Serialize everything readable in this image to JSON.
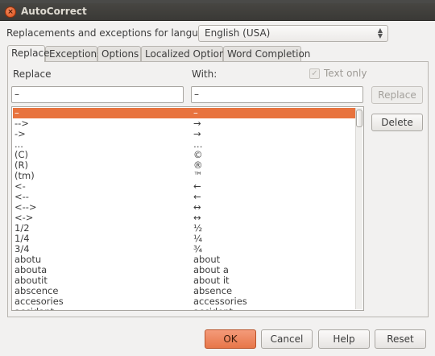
{
  "window": {
    "title": "AutoCorrect",
    "close_glyph": "×"
  },
  "language": {
    "label": "Replacements and exceptions for language:",
    "selected": "English (USA)"
  },
  "tabs": [
    {
      "label": "Replace",
      "active": true
    },
    {
      "label": "Exceptions",
      "active": false
    },
    {
      "label": "Options",
      "active": false
    },
    {
      "label": "Localized Options",
      "active": false
    },
    {
      "label": "Word Completion",
      "active": false
    }
  ],
  "replace_tab": {
    "replace_label": "Replace",
    "with_label": "With:",
    "text_only_label": "Text only",
    "text_only_checked": true,
    "replace_value": "–",
    "with_value": "–",
    "replace_button": "Replace",
    "delete_button": "Delete"
  },
  "entries": [
    {
      "replace": "–",
      "with": "–",
      "selected": true
    },
    {
      "replace": "-->",
      "with": "→"
    },
    {
      "replace": "->",
      "with": "→"
    },
    {
      "replace": "...",
      "with": "…"
    },
    {
      "replace": "(C)",
      "with": "©"
    },
    {
      "replace": "(R)",
      "with": "®"
    },
    {
      "replace": "(tm)",
      "with": "™"
    },
    {
      "replace": "<-",
      "with": "←"
    },
    {
      "replace": "<--",
      "with": "←"
    },
    {
      "replace": "<-->",
      "with": "↔"
    },
    {
      "replace": "<->",
      "with": "↔"
    },
    {
      "replace": "1/2",
      "with": "½"
    },
    {
      "replace": "1/4",
      "with": "¼"
    },
    {
      "replace": "3/4",
      "with": "¾"
    },
    {
      "replace": "abotu",
      "with": "about"
    },
    {
      "replace": "abouta",
      "with": "about a"
    },
    {
      "replace": "aboutit",
      "with": "about it"
    },
    {
      "replace": "abscence",
      "with": "absence"
    },
    {
      "replace": "accesories",
      "with": "accessories"
    },
    {
      "replace": "accidant",
      "with": "accident"
    }
  ],
  "footer": {
    "ok": "OK",
    "cancel": "Cancel",
    "help": "Help",
    "reset": "Reset"
  }
}
